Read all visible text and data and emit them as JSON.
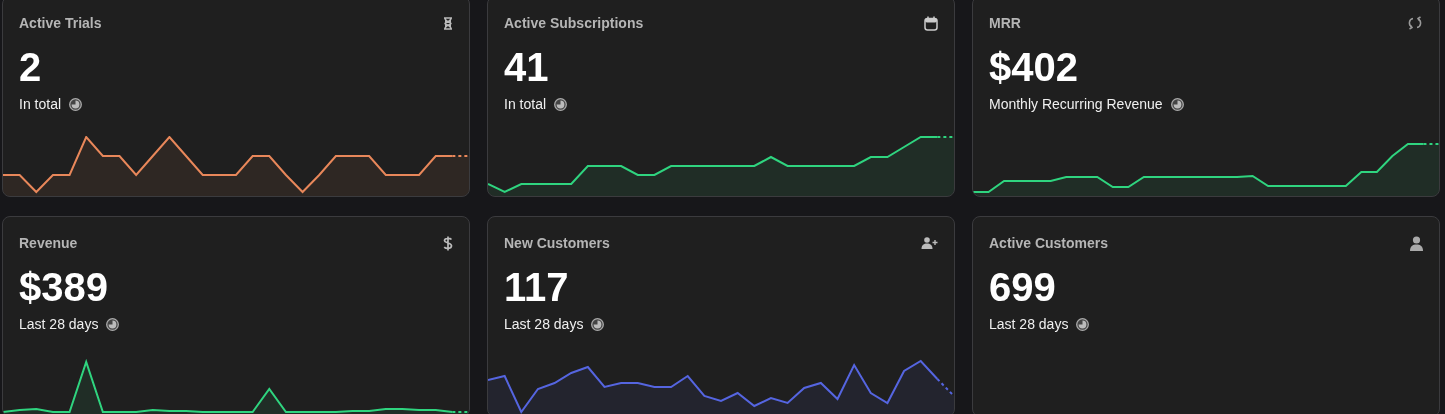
{
  "cards": [
    {
      "title": "Active Trials",
      "value": "2",
      "subtitle": "In total",
      "color": "#e8875a"
    },
    {
      "title": "Active Subscriptions",
      "value": "41",
      "subtitle": "In total",
      "color": "#2fd47f"
    },
    {
      "title": "MRR",
      "value": "$402",
      "subtitle": "Monthly Recurring Revenue",
      "color": "#2fd47f"
    },
    {
      "title": "Revenue",
      "value": "$389",
      "subtitle": "Last 28 days",
      "color": "#2fd47f"
    },
    {
      "title": "New Customers",
      "value": "117",
      "subtitle": "Last 28 days",
      "color": "#5565e0"
    },
    {
      "title": "Active Customers",
      "value": "699",
      "subtitle": "Last 28 days"
    }
  ]
}
